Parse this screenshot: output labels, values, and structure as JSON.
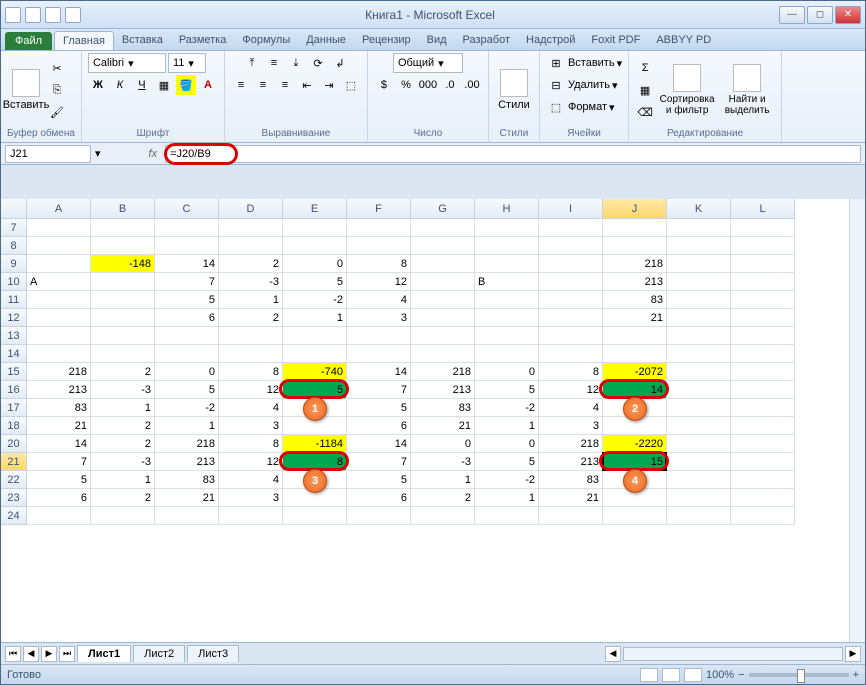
{
  "window": {
    "title": "Книга1 - Microsoft Excel"
  },
  "tabs": {
    "file": "Файл",
    "items": [
      "Главная",
      "Вставка",
      "Разметка",
      "Формулы",
      "Данные",
      "Рецензир",
      "Вид",
      "Разработ",
      "Надстрой",
      "Foxit PDF",
      "ABBYY PD"
    ],
    "active": 0
  },
  "ribbon": {
    "clipboard": {
      "paste": "Вставить",
      "label": "Буфер обмена"
    },
    "font": {
      "name": "Calibri",
      "size": "11",
      "label": "Шрифт"
    },
    "alignment": {
      "label": "Выравнивание"
    },
    "number": {
      "format": "Общий",
      "label": "Число"
    },
    "styles": {
      "label": "Стили",
      "btn": "Стили"
    },
    "cells": {
      "insert": "Вставить",
      "delete": "Удалить",
      "format": "Формат",
      "label": "Ячейки"
    },
    "editing": {
      "sort": "Сортировка и фильтр",
      "find": "Найти и выделить",
      "label": "Редактирование"
    }
  },
  "formula": {
    "namebox": "J21",
    "formula": "=J20/B9"
  },
  "columns": [
    "A",
    "B",
    "C",
    "D",
    "E",
    "F",
    "G",
    "H",
    "I",
    "J",
    "K",
    "L"
  ],
  "selected_col": "J",
  "selected_row": "21",
  "rows": [
    {
      "n": "7",
      "cells": [
        "",
        "",
        "",
        "",
        "",
        "",
        "",
        "",
        "",
        "",
        "",
        ""
      ]
    },
    {
      "n": "8",
      "cells": [
        "",
        "",
        "",
        "",
        "",
        "",
        "",
        "",
        "",
        "",
        "",
        ""
      ]
    },
    {
      "n": "9",
      "cells": [
        "",
        {
          "v": "-148",
          "cls": "yellow"
        },
        "14",
        "2",
        "0",
        "8",
        "",
        "",
        "",
        "218",
        "",
        ""
      ]
    },
    {
      "n": "10",
      "cells": [
        {
          "v": "A",
          "cls": "txt"
        },
        "",
        "7",
        "-3",
        "5",
        "12",
        "",
        {
          "v": "B",
          "cls": "txt"
        },
        "",
        "213",
        "",
        ""
      ]
    },
    {
      "n": "11",
      "cells": [
        "",
        "",
        "5",
        "1",
        "-2",
        "4",
        "",
        "",
        "",
        "83",
        "",
        ""
      ]
    },
    {
      "n": "12",
      "cells": [
        "",
        "",
        "6",
        "2",
        "1",
        "3",
        "",
        "",
        "",
        "21",
        "",
        ""
      ]
    },
    {
      "n": "13",
      "cells": [
        "",
        "",
        "",
        "",
        "",
        "",
        "",
        "",
        "",
        "",
        "",
        ""
      ]
    },
    {
      "n": "14",
      "cells": [
        "",
        "",
        "",
        "",
        "",
        "",
        "",
        "",
        "",
        "",
        "",
        ""
      ]
    },
    {
      "n": "15",
      "cells": [
        "218",
        "2",
        "0",
        "8",
        {
          "v": "-740",
          "cls": "yellow"
        },
        "14",
        "218",
        "0",
        "8",
        {
          "v": "-2072",
          "cls": "yellow"
        },
        "",
        ""
      ]
    },
    {
      "n": "16",
      "cells": [
        "213",
        "-3",
        "5",
        "12",
        {
          "v": "5",
          "cls": "green"
        },
        "7",
        "213",
        "5",
        "12",
        {
          "v": "14",
          "cls": "green"
        },
        "",
        ""
      ]
    },
    {
      "n": "17",
      "cells": [
        "83",
        "1",
        "-2",
        "4",
        "",
        "5",
        "83",
        "-2",
        "4",
        "",
        "",
        ""
      ]
    },
    {
      "n": "18",
      "cells": [
        "21",
        "2",
        "1",
        "3",
        "",
        "6",
        "21",
        "1",
        "3",
        "",
        "",
        ""
      ]
    },
    {
      "n": "19",
      "hidden": true,
      "cells": [
        "",
        "",
        "",
        "",
        "",
        "",
        "",
        "",
        "",
        "",
        "",
        ""
      ]
    },
    {
      "n": "20",
      "cells": [
        "14",
        "2",
        "218",
        "8",
        {
          "v": "-1184",
          "cls": "yellow"
        },
        "14",
        "0",
        "0",
        "218",
        {
          "v": "-2220",
          "cls": "yellow"
        },
        "",
        ""
      ]
    },
    {
      "n": "21",
      "cells": [
        "7",
        "-3",
        "213",
        "12",
        {
          "v": "8",
          "cls": "green"
        },
        "7",
        "-3",
        "5",
        "213",
        {
          "v": "15",
          "cls": "green selected"
        },
        "",
        ""
      ]
    },
    {
      "n": "22",
      "cells": [
        "5",
        "1",
        "83",
        "4",
        "",
        "5",
        "1",
        "-2",
        "83",
        "",
        "",
        ""
      ]
    },
    {
      "n": "23",
      "cells": [
        "6",
        "2",
        "21",
        "3",
        "",
        "6",
        "2",
        "1",
        "21",
        "",
        "",
        ""
      ]
    },
    {
      "n": "24",
      "cells": [
        "",
        "",
        "",
        "",
        "",
        "",
        "",
        "",
        "",
        "",
        "",
        ""
      ]
    }
  ],
  "annotations": {
    "circles": [
      {
        "col": "E",
        "row": "16",
        "label": "1"
      },
      {
        "col": "J",
        "row": "16",
        "label": "2"
      },
      {
        "col": "E",
        "row": "21",
        "label": "3"
      },
      {
        "col": "J",
        "row": "21",
        "label": "4"
      }
    ]
  },
  "sheets": {
    "items": [
      "Лист1",
      "Лист2",
      "Лист3"
    ],
    "active": 0
  },
  "status": {
    "ready": "Готово",
    "zoom": "100%"
  }
}
